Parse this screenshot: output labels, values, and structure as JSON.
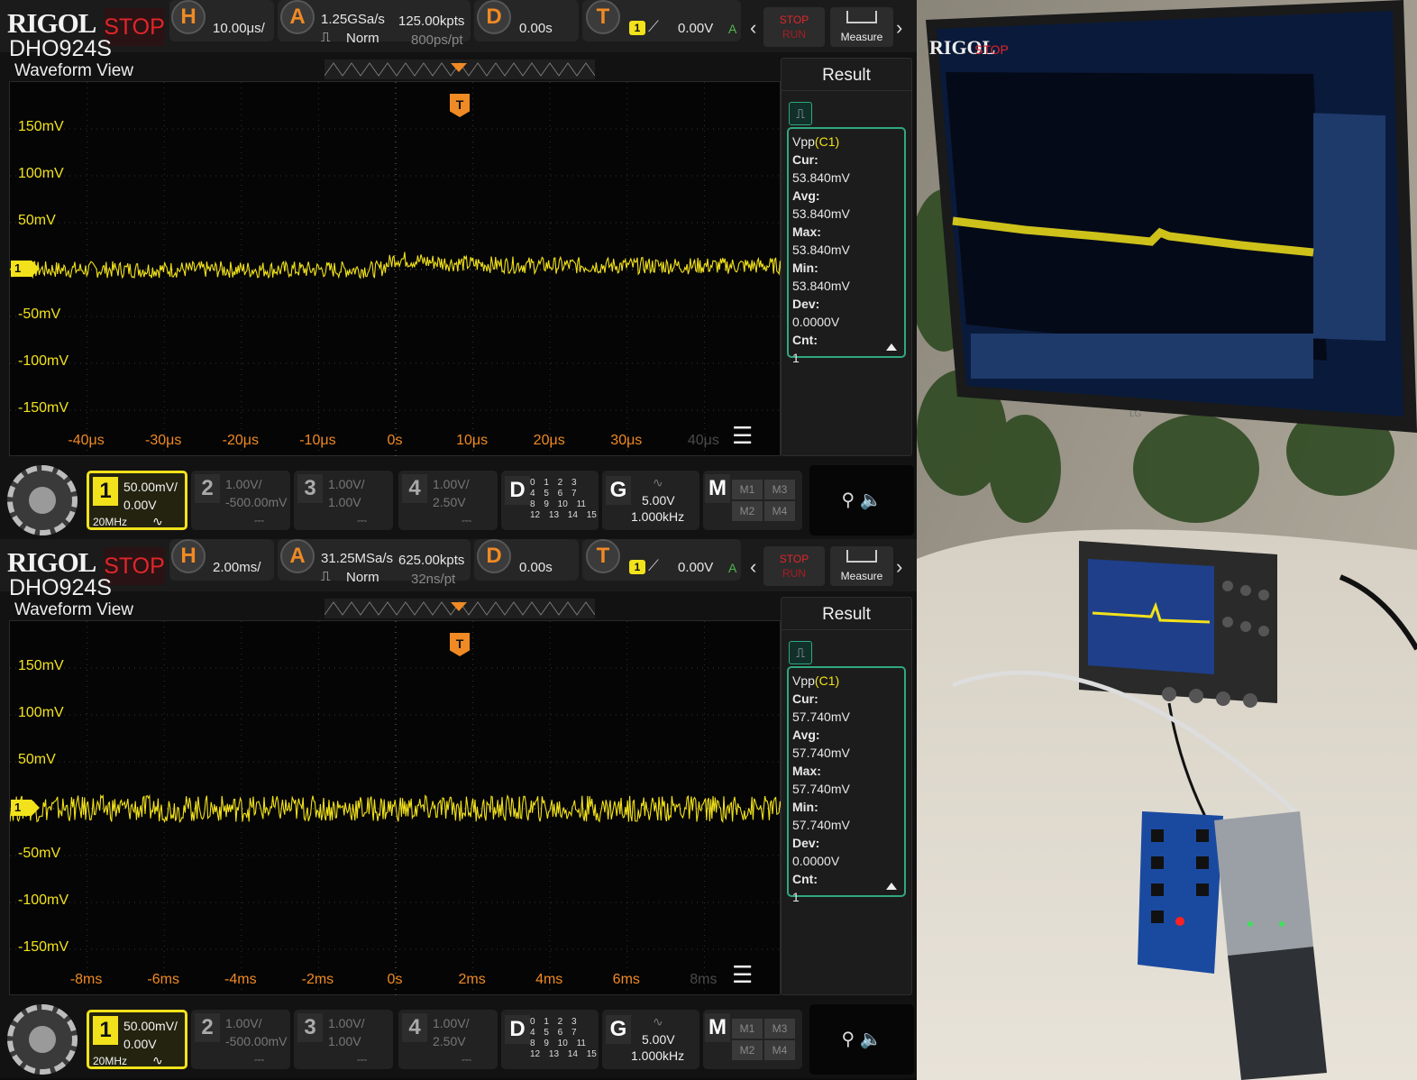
{
  "scopes": [
    {
      "brand": "RIGOL",
      "run_state": "STOP",
      "model": "DHO924S",
      "horizontal": {
        "letter": "H",
        "timebase": "10.00μs/"
      },
      "acquire": {
        "letter": "A",
        "sample_rate": "1.25GSa/s",
        "mode": "Norm",
        "memory_depth": "125.00kpts",
        "time_per_point": "800ps/pt"
      },
      "delay": {
        "letter": "D",
        "value": "0.00s"
      },
      "trigger": {
        "letter": "T",
        "source": "1",
        "level": "0.00V",
        "sweep": "A"
      },
      "run_button": {
        "stop": "STOP",
        "run": "RUN"
      },
      "measure_button": "Measure",
      "view_title": "Waveform View",
      "y_labels": [
        "150mV",
        "100mV",
        "50mV",
        "-50mV",
        "-100mV",
        "-150mV"
      ],
      "x_labels": [
        "-40μs",
        "-30μs",
        "-20μs",
        "-10μs",
        "0s",
        "10μs",
        "20μs",
        "30μs",
        "40μs"
      ],
      "trigger_marker": "T",
      "channel_marker": "1",
      "result": {
        "title": "Result",
        "item": "Vpp",
        "item_source": "(C1)",
        "rows": [
          {
            "label": "Cur:",
            "value": "53.840mV"
          },
          {
            "label": "Avg:",
            "value": "53.840mV"
          },
          {
            "label": "Max:",
            "value": "53.840mV"
          },
          {
            "label": "Min:",
            "value": "53.840mV"
          },
          {
            "label": "Dev:",
            "value": "0.0000V"
          },
          {
            "label": "Cnt:",
            "value": "1"
          }
        ]
      },
      "channels": [
        {
          "num": "1",
          "scale": "50.00mV/",
          "offset": "0.00V",
          "bw": "20MHz",
          "active": true
        },
        {
          "num": "2",
          "scale": "1.00V/",
          "offset": "-500.00mV",
          "active": false
        },
        {
          "num": "3",
          "scale": "1.00V/",
          "offset": "1.00V",
          "active": false
        },
        {
          "num": "4",
          "scale": "1.00V/",
          "offset": "2.50V",
          "active": false
        }
      ],
      "digital": {
        "letter": "D",
        "bits": [
          "0 1 2 3",
          "4 5 6 7",
          "8 9 10 11",
          "12 13 14 15"
        ]
      },
      "generator": {
        "letter": "G",
        "amplitude": "5.00V",
        "frequency": "1.000kHz"
      },
      "math": {
        "letter": "M",
        "items": [
          "M1",
          "M3",
          "M2",
          "M4"
        ]
      },
      "waveform": {
        "noise_mv": 9,
        "step_mv": 4,
        "step_at_div": 0
      }
    },
    {
      "brand": "RIGOL",
      "run_state": "STOP",
      "model": "DHO924S",
      "horizontal": {
        "letter": "H",
        "timebase": "2.00ms/"
      },
      "acquire": {
        "letter": "A",
        "sample_rate": "31.25MSa/s",
        "mode": "Norm",
        "memory_depth": "625.00kpts",
        "time_per_point": "32ns/pt"
      },
      "delay": {
        "letter": "D",
        "value": "0.00s"
      },
      "trigger": {
        "letter": "T",
        "source": "1",
        "level": "0.00V",
        "sweep": "A"
      },
      "run_button": {
        "stop": "STOP",
        "run": "RUN"
      },
      "measure_button": "Measure",
      "view_title": "Waveform View",
      "y_labels": [
        "150mV",
        "100mV",
        "50mV",
        "-50mV",
        "-100mV",
        "-150mV"
      ],
      "x_labels": [
        "-8ms",
        "-6ms",
        "-4ms",
        "-2ms",
        "0s",
        "2ms",
        "4ms",
        "6ms",
        "8ms"
      ],
      "trigger_marker": "T",
      "channel_marker": "1",
      "result": {
        "title": "Result",
        "item": "Vpp",
        "item_source": "(C1)",
        "rows": [
          {
            "label": "Cur:",
            "value": "57.740mV"
          },
          {
            "label": "Avg:",
            "value": "57.740mV"
          },
          {
            "label": "Max:",
            "value": "57.740mV"
          },
          {
            "label": "Min:",
            "value": "57.740mV"
          },
          {
            "label": "Dev:",
            "value": "0.0000V"
          },
          {
            "label": "Cnt:",
            "value": "1"
          }
        ]
      },
      "channels": [
        {
          "num": "1",
          "scale": "50.00mV/",
          "offset": "0.00V",
          "bw": "20MHz",
          "active": true
        },
        {
          "num": "2",
          "scale": "1.00V/",
          "offset": "-500.00mV",
          "active": false
        },
        {
          "num": "3",
          "scale": "1.00V/",
          "offset": "1.00V",
          "active": false
        },
        {
          "num": "4",
          "scale": "1.00V/",
          "offset": "2.50V",
          "active": false
        }
      ],
      "digital": {
        "letter": "D",
        "bits": [
          "0 1 2 3",
          "4 5 6 7",
          "8 9 10 11",
          "12 13 14 15"
        ]
      },
      "generator": {
        "letter": "G",
        "amplitude": "5.00V",
        "frequency": "1.000kHz"
      },
      "math": {
        "letter": "M",
        "items": [
          "M1",
          "M3",
          "M2",
          "M4"
        ]
      },
      "waveform": {
        "noise_mv": 14,
        "step_mv": 0,
        "step_at_div": 0
      }
    }
  ],
  "photo": {
    "monitor_brand": "RIGOL",
    "monitor_state": "STOP",
    "monitor_logo": "LG"
  },
  "colors": {
    "ch1": "#f2e21b",
    "accent": "#f08a24",
    "result_border": "#2fa880",
    "stop": "#e0262a"
  }
}
